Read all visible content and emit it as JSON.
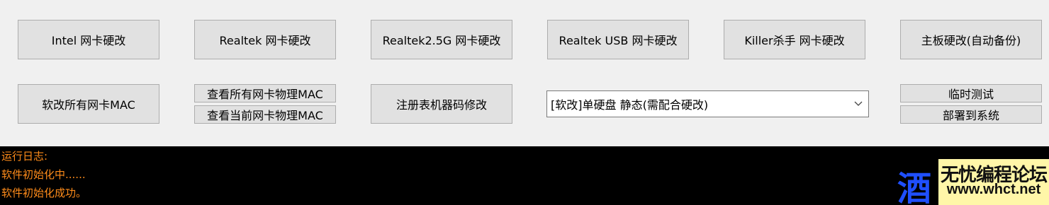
{
  "row1": {
    "intel": "Intel 网卡硬改",
    "realtek": "Realtek 网卡硬改",
    "realtek25g": "Realtek2.5G 网卡硬改",
    "realtek_usb": "Realtek USB 网卡硬改",
    "killer": "Killer杀手 网卡硬改",
    "mainboard": "主板硬改(自动备份)"
  },
  "row2": {
    "soft_mac": "软改所有网卡MAC",
    "view_all_mac": "查看所有网卡物理MAC",
    "view_current_mac": "查看当前网卡物理MAC",
    "registry_code": "注册表机器码修改",
    "mode_select": "[软改]单硬盘 静态(需配合硬改)",
    "temp_test": "临时测试",
    "deploy": "部署到系统"
  },
  "log": {
    "lines": [
      "运行日志:",
      "软件初始化中......",
      "软件初始化成功。"
    ]
  },
  "watermark": {
    "glyph": "酒",
    "title": "无忧编程论坛",
    "url": "www.whct.net"
  },
  "icons": {
    "combo_arrow": "chevron-down-icon"
  },
  "colors": {
    "log_text": "#ff8c1a",
    "log_bg": "#000000",
    "button_bg": "#e1e1e1"
  }
}
